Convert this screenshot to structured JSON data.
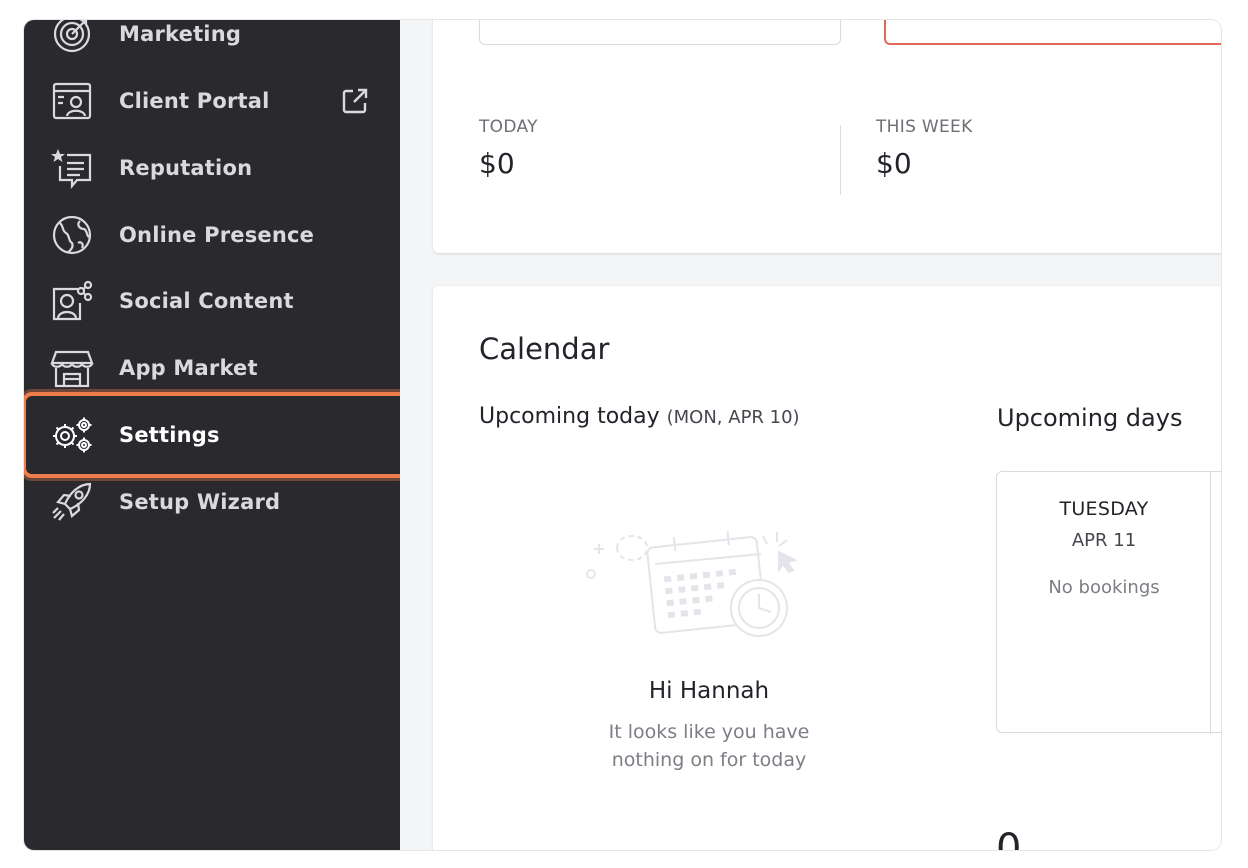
{
  "sidebar": {
    "items": [
      {
        "label": "Marketing",
        "icon": "target-icon"
      },
      {
        "label": "Client Portal",
        "icon": "client-portal-icon",
        "external": "external-link-icon"
      },
      {
        "label": "Reputation",
        "icon": "star-message-icon"
      },
      {
        "label": "Online Presence",
        "icon": "globe-icon"
      },
      {
        "label": "Social Content",
        "icon": "social-share-icon"
      },
      {
        "label": "App Market",
        "icon": "store-icon"
      },
      {
        "label": "Settings",
        "icon": "gears-icon",
        "active": true
      },
      {
        "label": "Setup Wizard",
        "icon": "rocket-icon"
      }
    ],
    "highlight_color": "#ee7d4b"
  },
  "stats": {
    "today": {
      "label": "TODAY",
      "value": "$0"
    },
    "this_week": {
      "label": "THIS WEEK",
      "value": "$0"
    }
  },
  "calendar": {
    "title": "Calendar",
    "upcoming_today": "Upcoming today",
    "today_date": "(MON,  APR 10)",
    "upcoming_days": "Upcoming days",
    "greeting": "Hi Hannah",
    "empty_message": "It looks like you have nothing on for today",
    "days": [
      {
        "name": "TUESDAY",
        "date": "APR 11",
        "status": "No bookings"
      }
    ],
    "bottom_peek": "0"
  }
}
